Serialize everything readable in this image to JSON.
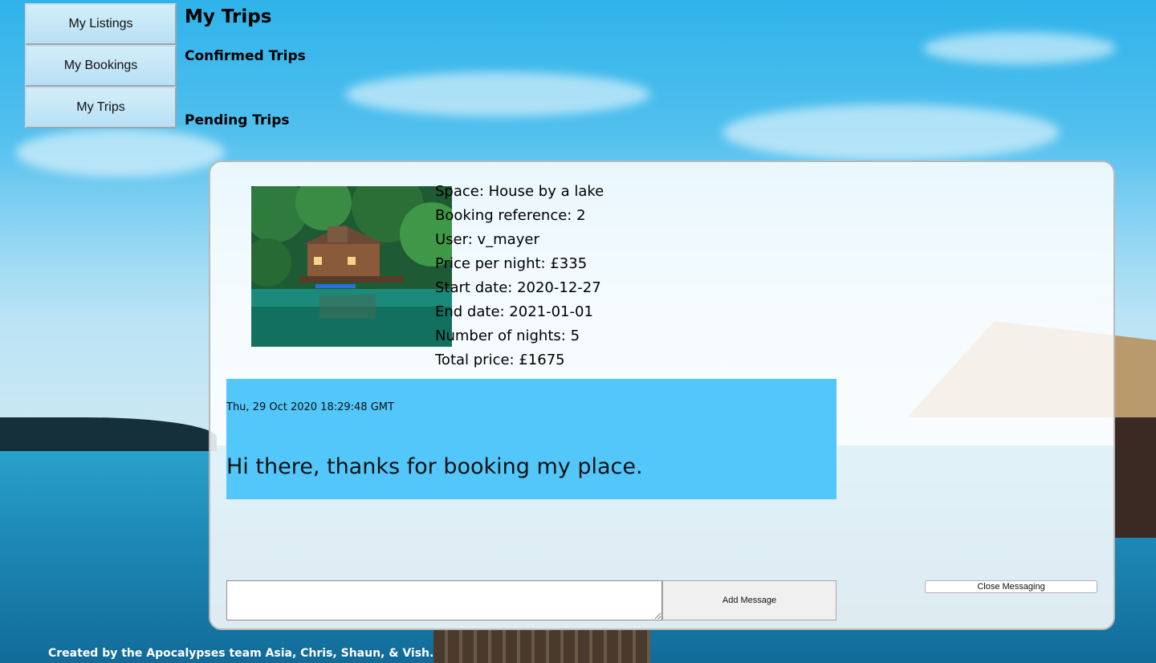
{
  "nav": {
    "items": [
      {
        "label": "My Listings"
      },
      {
        "label": "My Bookings"
      },
      {
        "label": "My Trips"
      }
    ]
  },
  "page": {
    "title": "My Trips",
    "confirmed_heading": "Confirmed Trips",
    "pending_heading": "Pending Trips"
  },
  "booking": {
    "space": "Space: House by a lake",
    "reference": "Booking reference: 2",
    "user": "User: v_mayer",
    "price_per_night": "Price per night: £335",
    "start_date": "Start date: 2020-12-27",
    "end_date": "End date: 2021-01-01",
    "nights": "Number of nights: 5",
    "total_price": "Total price: £1675"
  },
  "message": {
    "timestamp": "Thu, 29 Oct 2020 18:29:48 GMT",
    "text": "Hi there, thanks for booking my place."
  },
  "composer": {
    "input_value": "",
    "add_label": "Add Message",
    "close_label": "Close Messaging"
  },
  "footer": {
    "text": "Created by the Apocalypses team Asia, Chris, Shaun, & Vish."
  },
  "colors": {
    "message_bg": "#53c6fa",
    "nav_bg": "#c4e6f7"
  }
}
